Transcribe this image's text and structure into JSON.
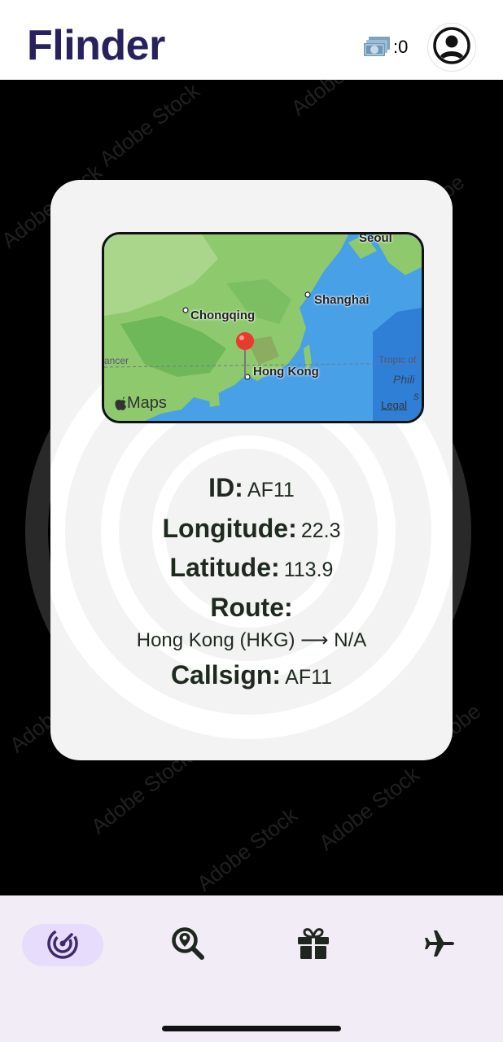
{
  "header": {
    "app_title": "Flinder",
    "coins": ":0",
    "icons": [
      "money-icon",
      "account-circle-icon"
    ]
  },
  "map": {
    "labels": {
      "seoul": "Seoul",
      "shanghai": "Shanghai",
      "chongqing": "Chongqing",
      "hongkong": "Hong Kong",
      "tropic": "Tropic of",
      "cancer": "ancer",
      "phili": "Phili",
      "s": "s"
    },
    "brand": "Maps",
    "legal": "Legal"
  },
  "flight": {
    "id_label": "ID:",
    "id_value": "AF11",
    "longitude_label": "Longitude:",
    "longitude_value": "22.3",
    "latitude_label": "Latitude:",
    "latitude_value": "113.9",
    "route_label": "Route:",
    "route_value": "Hong Kong (HKG) ⟶ N/A",
    "callsign_label": "Callsign:",
    "callsign_value": "AF11"
  },
  "tabs": [
    {
      "name": "radar",
      "icon": "radar-icon",
      "active": true
    },
    {
      "name": "search",
      "icon": "search-location-icon",
      "active": false
    },
    {
      "name": "gift",
      "icon": "gift-icon",
      "active": false
    },
    {
      "name": "flight",
      "icon": "airplane-icon",
      "active": false
    }
  ],
  "colors": {
    "title": "#27215e",
    "tab_active": "#e7dcfb",
    "tab_bar": "#f2ecf6"
  }
}
